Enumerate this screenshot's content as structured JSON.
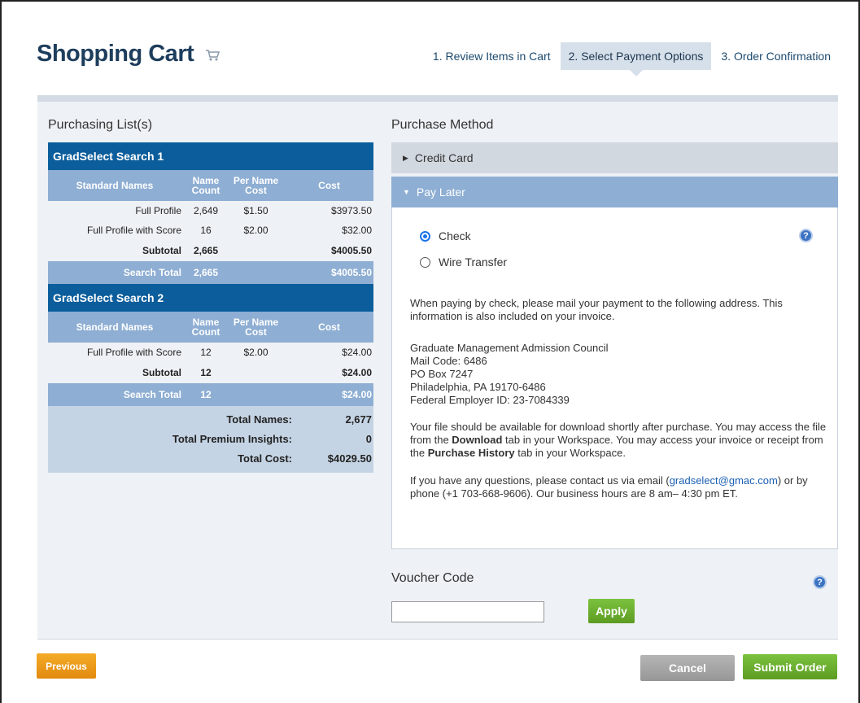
{
  "header": {
    "title": "Shopping Cart",
    "steps": [
      "1. Review Items in Cart",
      "2. Select Payment Options",
      "3. Order Confirmation"
    ],
    "active_step": 1
  },
  "purchasing": {
    "label": "Purchasing List(s)",
    "columns": [
      "Standard Names",
      "Name Count",
      "Per Name Cost",
      "Cost"
    ],
    "searches": [
      {
        "name": "GradSelect Search 1",
        "rows": [
          {
            "name": "Full Profile",
            "count": "2,649",
            "per": "$1.50",
            "cost": "$3973.50"
          },
          {
            "name": "Full Profile with Score",
            "count": "16",
            "per": "$2.00",
            "cost": "$32.00"
          }
        ],
        "subtotal_label": "Subtotal",
        "subtotal_count": "2,665",
        "subtotal_cost": "$4005.50",
        "total_label": "Search Total",
        "total_count": "2,665",
        "total_cost": "$4005.50"
      },
      {
        "name": "GradSelect Search 2",
        "rows": [
          {
            "name": "Full Profile with Score",
            "count": "12",
            "per": "$2.00",
            "cost": "$24.00"
          }
        ],
        "subtotal_label": "Subtotal",
        "subtotal_count": "12",
        "subtotal_cost": "$24.00",
        "total_label": "Search Total",
        "total_count": "12",
        "total_cost": "$24.00"
      }
    ],
    "totals": [
      {
        "label": "Total Names:",
        "value": "2,677"
      },
      {
        "label": "Total Premium Insights:",
        "value": "0"
      },
      {
        "label": "Total Cost:",
        "value": "$4029.50"
      }
    ]
  },
  "purchase_method": {
    "label": "Purchase Method",
    "credit_card": "Credit Card",
    "pay_later": "Pay Later",
    "options": [
      "Check",
      "Wire Transfer"
    ],
    "selected_option": "Check",
    "intro": "When paying by check, please mail your payment to the following address. This information is also included on your invoice.",
    "address": [
      "Graduate Management Admission Council",
      "Mail Code: 6486",
      "PO Box 7247",
      "Philadelphia, PA 19170-6486",
      "Federal Employer ID: 23-7084339"
    ],
    "file_text_1": "Your file should be available for download shortly after purchase. You may access the file from the ",
    "file_bold_1": "Download",
    "file_text_2": " tab in your Workspace. You may access your invoice or receipt from the ",
    "file_bold_2": "Purchase History",
    "file_text_3": " tab in your Workspace.",
    "contact_text_1": "If you have any questions, please contact us via email (",
    "contact_email": "gradselect@gmac.com",
    "contact_text_2": ") or by phone (+1 703-668-9606). Our business hours are 8 am– 4:30 pm ET."
  },
  "voucher": {
    "label": "Voucher Code",
    "value": "",
    "apply": "Apply"
  },
  "footer": {
    "previous": "Previous",
    "cancel": "Cancel",
    "submit": "Submit Order"
  },
  "icons": {
    "help": "?"
  }
}
